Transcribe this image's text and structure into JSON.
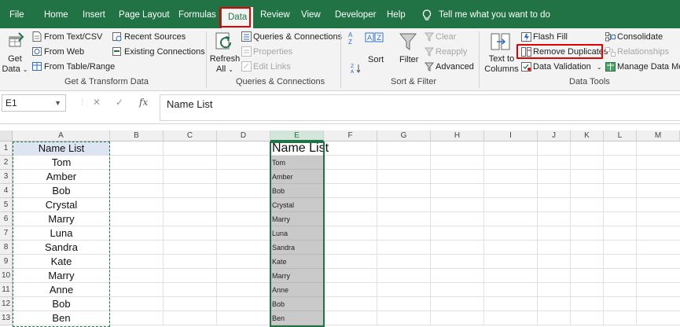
{
  "tabs": [
    {
      "label": "File"
    },
    {
      "label": "Home"
    },
    {
      "label": "Insert"
    },
    {
      "label": "Page Layout"
    },
    {
      "label": "Formulas"
    },
    {
      "label": "Data"
    },
    {
      "label": "Review"
    },
    {
      "label": "View"
    },
    {
      "label": "Developer"
    },
    {
      "label": "Help"
    }
  ],
  "tell_me": "Tell me what you want to do",
  "ribbon": {
    "get_data_line1": "Get",
    "get_data_line2": "Data",
    "from_text_csv": "From Text/CSV",
    "from_web": "From Web",
    "from_table_range": "From Table/Range",
    "recent_sources": "Recent Sources",
    "existing_connections": "Existing Connections",
    "group_get_transform": "Get & Transform Data",
    "refresh_all_line1": "Refresh",
    "refresh_all_line2": "All",
    "queries_connections": "Queries & Connections",
    "properties": "Properties",
    "edit_links": "Edit Links",
    "group_queries": "Queries & Connections",
    "sort_az_top": "A",
    "sort_az_bottom": "Z",
    "sort": "Sort",
    "filter": "Filter",
    "clear": "Clear",
    "reapply": "Reapply",
    "advanced": "Advanced",
    "group_sort_filter": "Sort & Filter",
    "text_to_columns_line1": "Text to",
    "text_to_columns_line2": "Columns",
    "flash_fill": "Flash Fill",
    "remove_duplicates": "Remove Duplicates",
    "data_validation": "Data Validation",
    "consolidate": "Consolidate",
    "relationships": "Relationships",
    "manage_data_model": "Manage Data Mod",
    "group_data_tools": "Data Tools"
  },
  "formula_bar": {
    "name_box": "E1",
    "cancel": "✕",
    "enter": "✓",
    "fx": "fx",
    "content": "Name List"
  },
  "columns": [
    "A",
    "B",
    "C",
    "D",
    "E",
    "F",
    "G",
    "H",
    "I",
    "J",
    "K",
    "L",
    "M"
  ],
  "rows": [
    "1",
    "2",
    "3",
    "4",
    "5",
    "6",
    "7",
    "8",
    "9",
    "10",
    "11",
    "12",
    "13"
  ],
  "colA": [
    "Name List",
    "Tom",
    "Amber",
    "Bob",
    "Crystal",
    "Marry",
    "Luna",
    "Sandra",
    "Kate",
    "Marry",
    "Anne",
    "Bob",
    "Ben"
  ],
  "colE_header": "Name List",
  "colE": [
    "Tom",
    "Amber",
    "Bob",
    "Crystal",
    "Marry",
    "Luna",
    "Sandra",
    "Kate",
    "Marry",
    "Anne",
    "Bob",
    "Ben"
  ],
  "colors": {
    "excel_green": "#217346",
    "highlight_red": "#e00000",
    "header_fill": "#dde5f3",
    "selected_fill": "#c9c9c9"
  }
}
